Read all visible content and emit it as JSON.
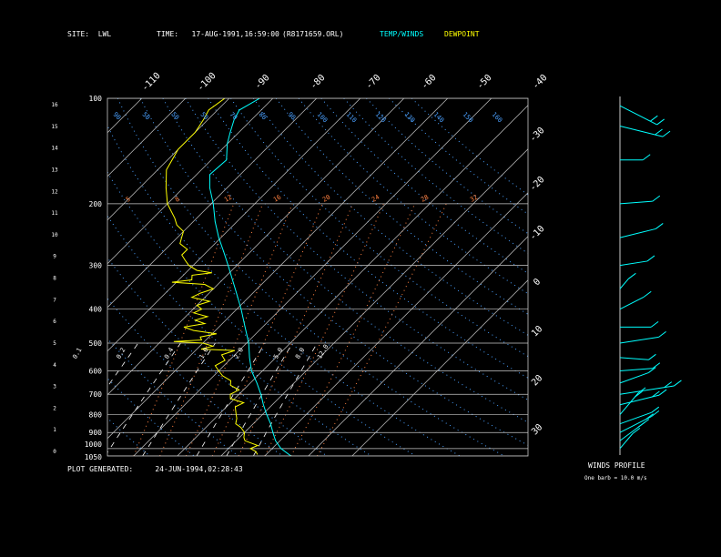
{
  "header": {
    "site": "SITE:  LWL",
    "time": "TIME:   17-AUG-1991,16:59:00",
    "file": "(R8171659.ORL)",
    "legend_temp": "TEMP/WINDS",
    "legend_dew": "DEWPOINT"
  },
  "footer": {
    "generated": "PLOT GENERATED:     24-JUN-1994,02:28:43"
  },
  "winds": {
    "title": "WINDS PROFILE",
    "note": "One barb = 10.0 m/s"
  },
  "colors": {
    "background": "#000000",
    "temperature": "#00ffff",
    "dewpoint": "#ffff00",
    "isotherm": "#c8c8c8",
    "isobar": "#c8c8c8",
    "dry_adiabat": "#4aa0ff",
    "moist_adiabat": "#ff8040",
    "mixing_ratio": "#ffffff"
  },
  "chart_data": {
    "type": "line",
    "subtype": "skew-T log-P diagram",
    "pressure_labels": [
      "100",
      "200",
      "300",
      "400",
      "500",
      "600",
      "700",
      "800",
      "900",
      "1000",
      "1050"
    ],
    "pressure_levels": [
      100,
      200,
      300,
      400,
      500,
      600,
      700,
      800,
      900,
      1000,
      1050
    ],
    "height_ticks": [
      "0",
      "1",
      "2",
      "3",
      "4",
      "5",
      "6",
      "7",
      "8",
      "9",
      "10",
      "11",
      "12",
      "13",
      "14",
      "15",
      "16"
    ],
    "isotherm_labels_top": [
      "-110",
      "-100",
      "-90",
      "-80",
      "-70",
      "-60",
      "-50",
      "-40"
    ],
    "isotherm_labels_right": [
      "-30",
      "-20",
      "-10",
      "0",
      "10",
      "20",
      "30"
    ],
    "isotherms": [
      -110,
      -100,
      -90,
      -80,
      -70,
      -60,
      -50,
      -40,
      -30,
      -20,
      -10,
      0,
      10,
      20,
      30
    ],
    "plim": [
      1050,
      100
    ],
    "mixing_ratio_labels": [
      {
        "text": "0.1",
        "p": 530,
        "t": -47
      },
      {
        "text": "0.2",
        "p": 530,
        "t": -37
      },
      {
        "text": "0.4",
        "p": 530,
        "t": -26
      },
      {
        "text": "1.0",
        "p": 530,
        "t": -18
      },
      {
        "text": "2.0",
        "p": 530,
        "t": -10
      },
      {
        "text": "5.0",
        "p": 530,
        "t": -1
      },
      {
        "text": "8.0",
        "p": 530,
        "t": 4
      },
      {
        "text": "12.0",
        "p": 530,
        "t": 9
      }
    ],
    "dry_adiabat_labels": [
      {
        "text": "90",
        "p": 110
      },
      {
        "text": "50",
        "p": 110
      },
      {
        "text": "50",
        "p": 110
      },
      {
        "text": "50",
        "p": 110
      },
      {
        "text": "70",
        "p": 110
      },
      {
        "text": "80",
        "p": 110
      },
      {
        "text": "90",
        "p": 110
      },
      {
        "text": "100",
        "p": 110
      },
      {
        "text": "110",
        "p": 110
      },
      {
        "text": "120",
        "p": 110
      },
      {
        "text": "130",
        "p": 110
      },
      {
        "text": "140",
        "p": 110
      },
      {
        "text": "150",
        "p": 110
      },
      {
        "text": "160",
        "p": 110
      }
    ],
    "moist_adiabat_labels": [
      "5",
      "8",
      "12",
      "16",
      "20",
      "24",
      "28",
      "32"
    ],
    "series": [
      {
        "name": "TEMP/WINDS",
        "color": "#00ffff",
        "points": [
          [
            1050,
            26
          ],
          [
            1000,
            22
          ],
          [
            950,
            19
          ],
          [
            900,
            16.5
          ],
          [
            850,
            14
          ],
          [
            800,
            11
          ],
          [
            750,
            8
          ],
          [
            700,
            5
          ],
          [
            650,
            1.5
          ],
          [
            600,
            -2.5
          ],
          [
            550,
            -6
          ],
          [
            500,
            -9.5
          ],
          [
            450,
            -14
          ],
          [
            400,
            -19
          ],
          [
            350,
            -25
          ],
          [
            300,
            -32
          ],
          [
            275,
            -36
          ],
          [
            250,
            -40.5
          ],
          [
            225,
            -45
          ],
          [
            200,
            -49.5
          ],
          [
            180,
            -54
          ],
          [
            165,
            -57
          ],
          [
            150,
            -56.5
          ],
          [
            135,
            -60
          ],
          [
            125,
            -62
          ],
          [
            115,
            -64
          ],
          [
            108,
            -65
          ],
          [
            100,
            -63
          ]
        ]
      },
      {
        "name": "DEWPOINT",
        "color": "#ffff00",
        "points": [
          [
            1040,
            18
          ],
          [
            1020,
            17
          ],
          [
            1000,
            15
          ],
          [
            980,
            16
          ],
          [
            950,
            12
          ],
          [
            930,
            11
          ],
          [
            900,
            10
          ],
          [
            870,
            8
          ],
          [
            850,
            6
          ],
          [
            820,
            5
          ],
          [
            800,
            4
          ],
          [
            760,
            2
          ],
          [
            740,
            3
          ],
          [
            720,
            -1
          ],
          [
            700,
            -2
          ],
          [
            680,
            -1
          ],
          [
            660,
            -4
          ],
          [
            640,
            -5
          ],
          [
            620,
            -8
          ],
          [
            600,
            -10
          ],
          [
            580,
            -12
          ],
          [
            560,
            -11
          ],
          [
            540,
            -13
          ],
          [
            525,
            -11
          ],
          [
            520,
            -19
          ],
          [
            510,
            -17
          ],
          [
            500,
            -20
          ],
          [
            495,
            -27
          ],
          [
            490,
            -21
          ],
          [
            480,
            -22
          ],
          [
            470,
            -19
          ],
          [
            460,
            -25
          ],
          [
            450,
            -28
          ],
          [
            440,
            -24
          ],
          [
            430,
            -27
          ],
          [
            420,
            -25
          ],
          [
            410,
            -29
          ],
          [
            400,
            -28
          ],
          [
            390,
            -30
          ],
          [
            380,
            -28
          ],
          [
            370,
            -33
          ],
          [
            360,
            -32
          ],
          [
            350,
            -30
          ],
          [
            340,
            -33
          ],
          [
            335,
            -41
          ],
          [
            330,
            -37
          ],
          [
            320,
            -38
          ],
          [
            315,
            -34
          ],
          [
            310,
            -38
          ],
          [
            300,
            -41
          ],
          [
            290,
            -43
          ],
          [
            280,
            -45
          ],
          [
            270,
            -45
          ],
          [
            260,
            -48
          ],
          [
            250,
            -49
          ],
          [
            240,
            -50
          ],
          [
            230,
            -53
          ],
          [
            220,
            -55
          ],
          [
            200,
            -60
          ],
          [
            180,
            -64
          ],
          [
            160,
            -68
          ],
          [
            140,
            -70
          ],
          [
            125,
            -70
          ],
          [
            115,
            -71
          ],
          [
            108,
            -72
          ],
          [
            100,
            -71
          ]
        ]
      }
    ],
    "wind_profile": {
      "units": "m/s",
      "barb_value": 10.0,
      "samples": [
        {
          "p": 1000,
          "dir": 200,
          "speed": 12
        },
        {
          "p": 950,
          "dir": 210,
          "speed": 15
        },
        {
          "p": 900,
          "dir": 220,
          "speed": 18
        },
        {
          "p": 850,
          "dir": 230,
          "speed": 14
        },
        {
          "p": 800,
          "dir": 200,
          "speed": 20
        },
        {
          "p": 750,
          "dir": 240,
          "speed": 16
        },
        {
          "p": 700,
          "dir": 250,
          "speed": 22
        },
        {
          "p": 650,
          "dir": 230,
          "speed": 12
        },
        {
          "p": 600,
          "dir": 260,
          "speed": 10
        },
        {
          "p": 550,
          "dir": 280,
          "speed": 8
        },
        {
          "p": 500,
          "dir": 250,
          "speed": 14
        },
        {
          "p": 450,
          "dir": 270,
          "speed": 9
        },
        {
          "p": 400,
          "dir": 220,
          "speed": 12
        },
        {
          "p": 350,
          "dir": 200,
          "speed": 6
        },
        {
          "p": 300,
          "dir": 250,
          "speed": 8
        },
        {
          "p": 250,
          "dir": 240,
          "speed": 14
        },
        {
          "p": 200,
          "dir": 260,
          "speed": 10
        },
        {
          "p": 150,
          "dir": 270,
          "speed": 5
        },
        {
          "p": 120,
          "dir": 300,
          "speed": 18
        },
        {
          "p": 105,
          "dir": 320,
          "speed": 22
        }
      ]
    }
  }
}
